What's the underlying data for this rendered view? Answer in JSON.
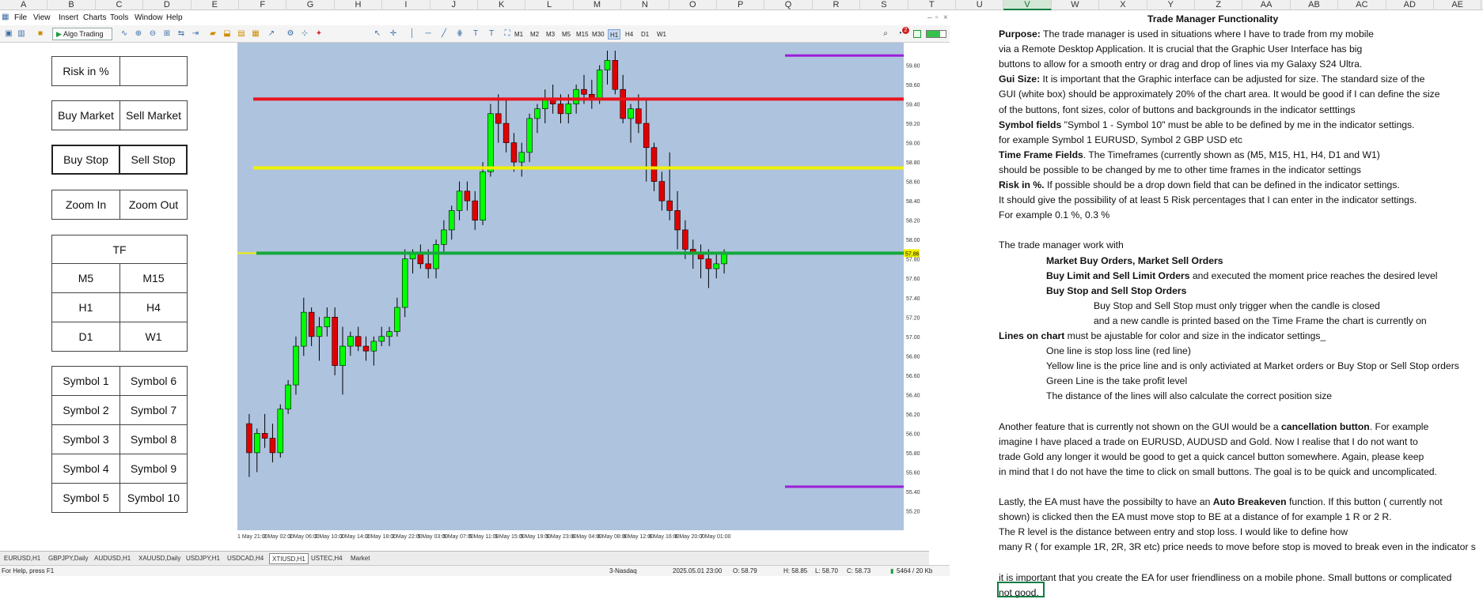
{
  "columns": [
    "A",
    "B",
    "C",
    "D",
    "E",
    "F",
    "G",
    "H",
    "I",
    "J",
    "K",
    "L",
    "M",
    "N",
    "O",
    "P",
    "Q",
    "R",
    "S",
    "T",
    "U",
    "V",
    "W",
    "X",
    "Y",
    "Z",
    "AA",
    "AB",
    "AC",
    "AD",
    "AE"
  ],
  "selected_column": "V",
  "menu": [
    "File",
    "View",
    "Insert",
    "Charts",
    "Tools",
    "Window",
    "Help"
  ],
  "toolbar": {
    "algo_trading": "Algo Trading",
    "timeframes": [
      "M1",
      "M2",
      "M3",
      "M5",
      "M15",
      "M30",
      "H1",
      "H4",
      "D1",
      "W1"
    ],
    "active_tf": "H1",
    "notification_count": "2"
  },
  "gui": {
    "risk_label": "Risk in %",
    "risk_value": "",
    "buy_market": "Buy Market",
    "sell_market": "Sell Market",
    "buy_stop": "Buy Stop",
    "sell_stop": "Sell Stop",
    "zoom_in": "Zoom In",
    "zoom_out": "Zoom Out",
    "tf_title": "TF",
    "tf_buttons": [
      "M5",
      "M15",
      "H1",
      "H4",
      "D1",
      "W1"
    ],
    "symbols": [
      "Symbol 1",
      "Symbol 6",
      "Symbol 2",
      "Symbol 7",
      "Symbol 3",
      "Symbol 8",
      "Symbol 4",
      "Symbol 9",
      "Symbol 5",
      "Symbol 10"
    ]
  },
  "chart": {
    "price_ticks": [
      "59.80",
      "59.60",
      "59.40",
      "59.20",
      "59.00",
      "58.80",
      "58.60",
      "58.40",
      "58.20",
      "58.00",
      "57.80",
      "57.60",
      "57.40",
      "57.20",
      "57.00",
      "56.80",
      "56.60",
      "56.40",
      "56.20",
      "56.00",
      "55.80",
      "55.60",
      "55.40",
      "55.20"
    ],
    "time_ticks": [
      "1 May 21:00",
      "2 May 02:00",
      "2 May 06:00",
      "2 May 10:00",
      "2 May 14:00",
      "2 May 18:00",
      "2 May 22:00",
      "5 May 03:00",
      "5 May 07:00",
      "5 May 11:00",
      "5 May 15:00",
      "5 May 19:00",
      "5 May 23:00",
      "6 May 04:00",
      "6 May 08:00",
      "6 May 12:00",
      "6 May 16:00",
      "6 May 20:00",
      "7 May 01:00"
    ],
    "colors": {
      "stop_loss": "#e8141e",
      "price_line": "#f0f000",
      "take_profit": "#14a83c",
      "range_marker": "#9b1ed8",
      "bull": "#00ff00",
      "bear": "#e00000"
    },
    "stop_loss_price": 59.45,
    "price_line_price": 58.74,
    "take_profit_price": 57.86,
    "range_top_price": 59.9,
    "range_bottom_price": 55.45,
    "current_price_tag": "57.86"
  },
  "tabs": [
    "EURUSD,H1",
    "GBPJPY,Daily",
    "AUDUSD,H1",
    "XAUUSD,Daily",
    "USDJPY,H1",
    "USDCAD,H4",
    "XTIUSD,H1",
    "USTEC,H4",
    "Market"
  ],
  "active_tab": "XTIUSD,H1",
  "status": {
    "help": "For Help, press F1",
    "profile": "3-Nasdaq",
    "datetime": "2025.05.01 23:00",
    "open": "O: 58.79",
    "high": "H: 58.85",
    "low": "L: 58.70",
    "close": "C: 58.73",
    "traffic": "5464 / 20 Kb"
  },
  "doc": {
    "title": "Trade Manager Functionality",
    "lines": [
      {
        "b": "Purpose:",
        "t": " The trade manager is used in situations where I have to trade from my mobile",
        "indent": 0
      },
      {
        "b": "",
        "t": "via a Remote Desktop Application. It is crucial that the Graphic User Interface has big",
        "indent": 0
      },
      {
        "b": "",
        "t": "buttons to allow for a smooth entry or drag and drop of lines via my Galaxy S24 Ultra.",
        "indent": 0
      },
      {
        "b": "Gui Size:",
        "t": " It is important that the Graphic interface can be adjusted for size. The standard size of the",
        "indent": 0
      },
      {
        "b": "",
        "t": "GUI (white box) should be approximately 20% of the chart area. It would be good if I can define the size",
        "indent": 0
      },
      {
        "b": "",
        "t": "of the buttons, font sizes, color of buttons and backgrounds in the indicator setttings",
        "indent": 0
      },
      {
        "b": "Symbol fields",
        "t": " \"Symbol 1 - Symbol 10\" must be able to be defined by me in the indicator settings.",
        "indent": 0
      },
      {
        "b": "",
        "t": "for example Symbol 1 EURUSD, Symbol 2 GBP USD etc",
        "indent": 0
      },
      {
        "b": "Time Frame Fields",
        "t": ". The Timeframes (currently shown as (M5, M15, H1, H4, D1 and W1)",
        "indent": 0
      },
      {
        "b": "",
        "t": "should be possible to be changed by me to other time frames in the indicator settings",
        "indent": 0
      },
      {
        "b": "Risk in %.",
        "t": "  If possible should be a drop down field that can be defined in the indicator settings.",
        "indent": 0
      },
      {
        "b": "",
        "t": "It should give the possibility of at least 5 Risk percentages that I can enter in the indicator settings.",
        "indent": 0
      },
      {
        "b": "",
        "t": " For example 0.1 %, 0.3 %",
        "indent": 0
      },
      {
        "b": "",
        "t": "",
        "indent": 0
      },
      {
        "b": "",
        "t": "The trade manager work with",
        "indent": 0
      },
      {
        "b": "Market Buy Orders, Market Sell Orders",
        "t": "",
        "indent": 1
      },
      {
        "b": "Buy Limit and Sell Limit Orders",
        "t": " and executed the moment price reaches the desired level",
        "indent": 1
      },
      {
        "b": "Buy Stop and Sell Stop Orders",
        "t": "",
        "indent": 1
      },
      {
        "b": "",
        "t": "Buy Stop and Sell Stop must only trigger when the candle is closed",
        "indent": 2
      },
      {
        "b": "",
        "t": "and a new candle is printed based on the Time Frame the chart is currently on",
        "indent": 2
      },
      {
        "b": "Lines on chart",
        "t": " must be ajustable for color and size in the indicator settings_",
        "indent": 0
      },
      {
        "b": "",
        "t": "One line is stop loss line (red line)",
        "indent": 1
      },
      {
        "b": "",
        "t": "Yellow line is the price line and is only activiated at Market orders or Buy Stop or Sell Stop orders",
        "indent": 1
      },
      {
        "b": "",
        "t": "Green Line is the take profit level",
        "indent": 1
      },
      {
        "b": "",
        "t": "The distance of the lines will also calculate the correct position size",
        "indent": 1
      },
      {
        "b": "",
        "t": "",
        "indent": 0
      },
      {
        "b": "",
        "t": "Another feature that is currently not shown on the GUI would be a ",
        "indent": 0,
        "b2": "cancellation button",
        "t2": ". For example"
      },
      {
        "b": "",
        "t": "imagine I have placed a trade on EURUSD, AUDUSD and Gold. Now I realise that I do not want to",
        "indent": 0
      },
      {
        "b": "",
        "t": "trade Gold any longer it would be good to get a quick cancel button somewhere. Again, please keep",
        "indent": 0
      },
      {
        "b": "",
        "t": "in mind that I do not have the time to click on small buttons. The goal is to be quick and uncomplicated.",
        "indent": 0
      },
      {
        "b": "",
        "t": "",
        "indent": 0
      },
      {
        "b": "",
        "t": "Lastly, the EA must have the possibilty to have an ",
        "indent": 0,
        "b2": "Auto Breakeven",
        "t2": " function. If this button ( currently not"
      },
      {
        "b": "",
        "t": "shown) is clicked then the EA must move stop to BE at a distance of for example 1 R or 2 R.",
        "indent": 0
      },
      {
        "b": "",
        "t": " The R level is the distance between entry and stop loss. I would like to define how",
        "indent": 0
      },
      {
        "b": "",
        "t": "many R ( for example 1R, 2R, 3R etc) price needs to move before stop is moved to break even in the indicator s",
        "indent": 0
      },
      {
        "b": "",
        "t": "",
        "indent": 0
      },
      {
        "b": "",
        "t": "it is important that you create the EA for user friendliness on a mobile phone. Small buttons or complicated",
        "indent": 0
      },
      {
        "b": "",
        "t": "not good.",
        "indent": 0
      }
    ]
  },
  "candles": [
    [
      56.1,
      56.2,
      55.55,
      55.8
    ],
    [
      55.8,
      56.05,
      55.6,
      56.0
    ],
    [
      56.0,
      56.2,
      55.85,
      55.95
    ],
    [
      55.95,
      56.1,
      55.7,
      55.8
    ],
    [
      55.8,
      56.3,
      55.75,
      56.25
    ],
    [
      56.25,
      56.55,
      56.2,
      56.5
    ],
    [
      56.5,
      57.0,
      56.4,
      56.9
    ],
    [
      56.9,
      57.4,
      56.8,
      57.25
    ],
    [
      57.25,
      57.3,
      56.9,
      57.0
    ],
    [
      57.0,
      57.2,
      56.75,
      57.1
    ],
    [
      57.1,
      57.3,
      57.0,
      57.2
    ],
    [
      57.2,
      57.3,
      56.6,
      56.7
    ],
    [
      56.7,
      57.1,
      56.4,
      56.9
    ],
    [
      56.9,
      57.05,
      56.8,
      57.0
    ],
    [
      57.0,
      57.1,
      56.85,
      56.9
    ],
    [
      56.9,
      57.0,
      56.75,
      56.85
    ],
    [
      56.85,
      57.0,
      56.7,
      56.95
    ],
    [
      56.95,
      57.1,
      56.9,
      57.0
    ],
    [
      57.0,
      57.1,
      56.9,
      57.05
    ],
    [
      57.05,
      57.4,
      57.0,
      57.3
    ],
    [
      57.3,
      57.9,
      57.2,
      57.8
    ],
    [
      57.8,
      57.9,
      57.65,
      57.85
    ],
    [
      57.85,
      57.95,
      57.7,
      57.75
    ],
    [
      57.75,
      57.9,
      57.6,
      57.7
    ],
    [
      57.7,
      58.0,
      57.6,
      57.95
    ],
    [
      57.95,
      58.2,
      57.85,
      58.1
    ],
    [
      58.1,
      58.35,
      58.0,
      58.3
    ],
    [
      58.3,
      58.6,
      58.2,
      58.5
    ],
    [
      58.5,
      58.6,
      58.3,
      58.4
    ],
    [
      58.4,
      58.5,
      58.1,
      58.2
    ],
    [
      58.2,
      58.8,
      58.15,
      58.7
    ],
    [
      58.7,
      59.4,
      58.65,
      59.3
    ],
    [
      59.3,
      59.5,
      59.0,
      59.2
    ],
    [
      59.2,
      59.45,
      58.9,
      59.0
    ],
    [
      59.0,
      59.1,
      58.7,
      58.8
    ],
    [
      58.8,
      59.0,
      58.65,
      58.9
    ],
    [
      58.9,
      59.3,
      58.8,
      59.25
    ],
    [
      59.25,
      59.4,
      59.1,
      59.35
    ],
    [
      59.35,
      59.55,
      59.2,
      59.45
    ],
    [
      59.45,
      59.6,
      59.3,
      59.4
    ],
    [
      59.4,
      59.5,
      59.2,
      59.3
    ],
    [
      59.3,
      59.5,
      59.2,
      59.4
    ],
    [
      59.4,
      59.6,
      59.3,
      59.55
    ],
    [
      59.55,
      59.7,
      59.4,
      59.5
    ],
    [
      59.5,
      59.65,
      59.35,
      59.45
    ],
    [
      59.45,
      59.8,
      59.4,
      59.75
    ],
    [
      59.75,
      59.95,
      59.6,
      59.85
    ],
    [
      59.85,
      59.95,
      59.5,
      59.55
    ],
    [
      59.55,
      59.7,
      59.2,
      59.25
    ],
    [
      59.25,
      59.4,
      59.0,
      59.35
    ],
    [
      59.35,
      59.5,
      59.1,
      59.2
    ],
    [
      59.2,
      59.45,
      58.6,
      58.95
    ],
    [
      58.95,
      59.0,
      58.5,
      58.6
    ],
    [
      58.6,
      58.7,
      58.3,
      58.4
    ],
    [
      58.4,
      58.9,
      58.2,
      58.3
    ],
    [
      58.3,
      58.5,
      57.9,
      58.1
    ],
    [
      58.1,
      58.2,
      57.8,
      57.9
    ],
    [
      57.9,
      58.0,
      57.7,
      57.85
    ],
    [
      57.85,
      57.95,
      57.6,
      57.8
    ],
    [
      57.8,
      57.9,
      57.5,
      57.7
    ],
    [
      57.7,
      57.85,
      57.6,
      57.75
    ],
    [
      57.75,
      57.9,
      57.65,
      57.85
    ]
  ]
}
